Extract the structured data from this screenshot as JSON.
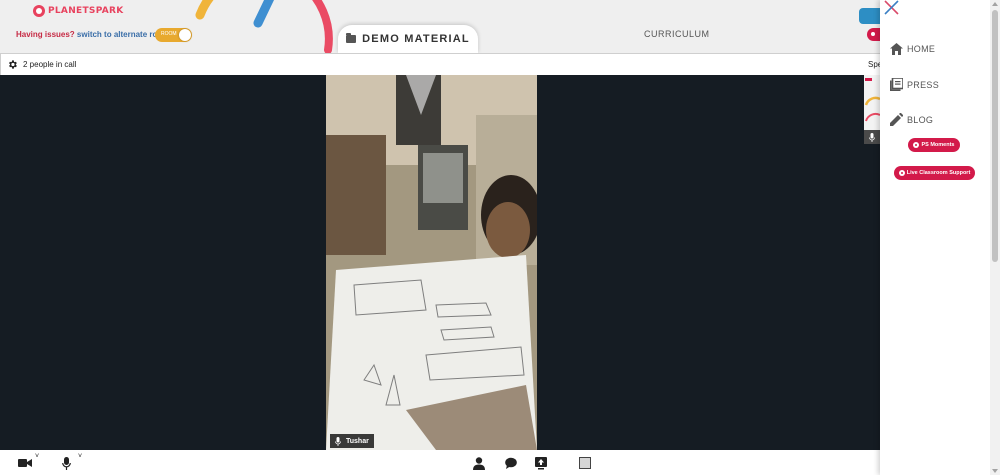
{
  "header": {
    "logo_text": "PLANETSPARK",
    "issue_question": "Having issues?",
    "issue_link": "switch to alternate room",
    "room_toggle_label": "ROOM",
    "demo_button_label": "DEMO MATERIAL",
    "curriculum_label": "CURRICULUM"
  },
  "call": {
    "people_count_text": "2 people in call",
    "speaker_view_label": "Spe"
  },
  "video": {
    "participant_name": "Tushar"
  },
  "toolbar": {
    "camera_caret": "˅",
    "mic_caret": "˅",
    "icons": [
      "camera-icon",
      "microphone-icon",
      "participants-icon",
      "chat-icon",
      "share-screen-icon",
      "whiteboard-icon"
    ]
  },
  "sidebar": {
    "nav": [
      {
        "label": "HOME",
        "icon": "home-icon"
      },
      {
        "label": "PRESS",
        "icon": "press-icon"
      },
      {
        "label": "BLOG",
        "icon": "pencil-icon"
      }
    ],
    "ps_moments_label": "PS Moments",
    "classroom_support_label": "Live Classroom Support"
  },
  "colors": {
    "brand_red": "#d31a4a",
    "toggle_yellow": "#e8a92e",
    "stage_dark": "#151c23",
    "link_blue": "#3a6ea8"
  }
}
